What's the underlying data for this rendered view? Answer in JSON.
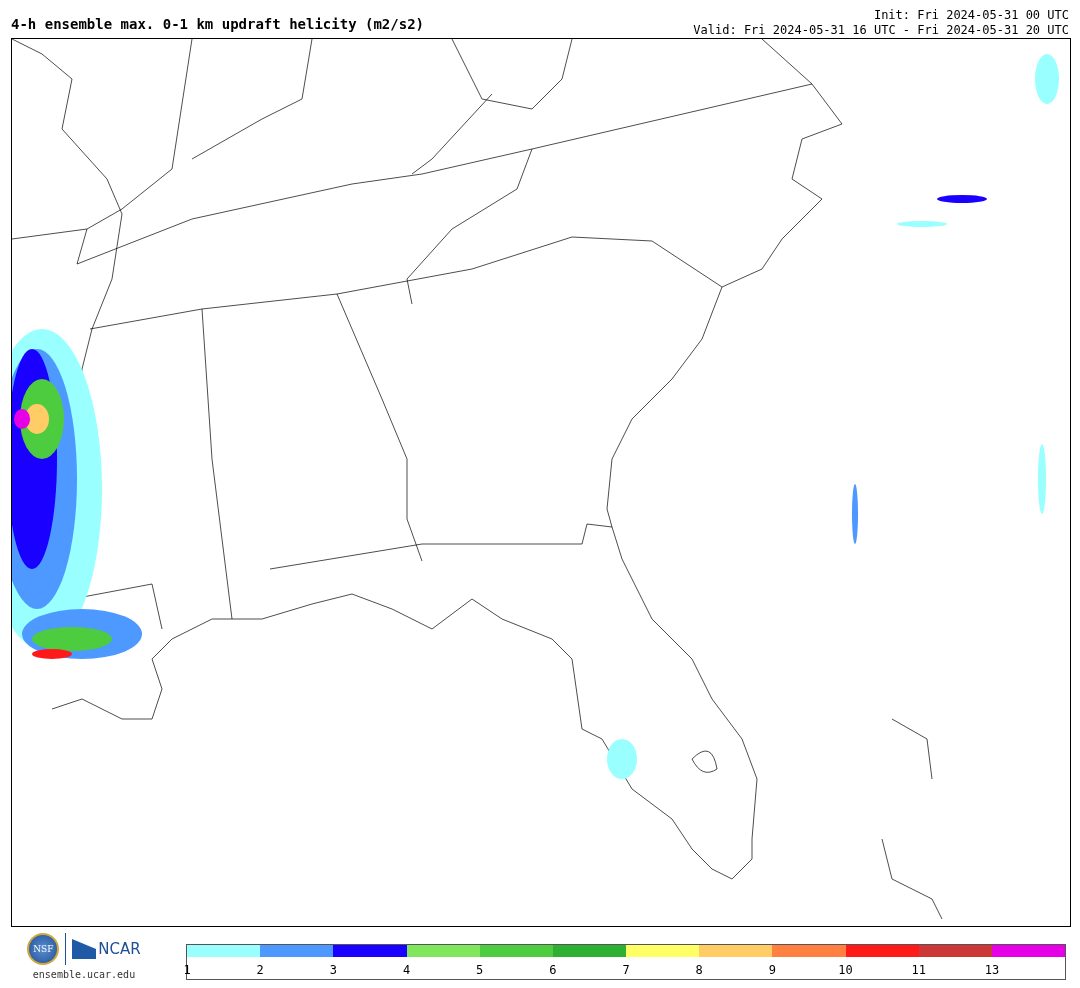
{
  "header": {
    "title": "4-h ensemble max. 0-1 km updraft helicity (m2/s2)",
    "init": "Init: Fri 2024-05-31 00 UTC",
    "valid": "Valid: Fri 2024-05-31 16 UTC - Fri 2024-05-31 20 UTC"
  },
  "footer": {
    "nsf_logo": "NSF",
    "ncar_logo": "NCAR",
    "site": "ensemble.ucar.edu"
  },
  "colorbar": [
    {
      "label": "1",
      "color": "#99ffff"
    },
    {
      "label": "2",
      "color": "#4d99ff"
    },
    {
      "label": "3",
      "color": "#1a00ff"
    },
    {
      "label": "4",
      "color": "#80e65c"
    },
    {
      "label": "5",
      "color": "#4dcc40"
    },
    {
      "label": "6",
      "color": "#2eb033"
    },
    {
      "label": "7",
      "color": "#ffff66"
    },
    {
      "label": "8",
      "color": "#ffcc66"
    },
    {
      "label": "9",
      "color": "#ff8040"
    },
    {
      "label": "10",
      "color": "#ff1a1a"
    },
    {
      "label": "11",
      "color": "#cc3838"
    },
    {
      "label": "13",
      "color": "#e600e6"
    }
  ]
}
